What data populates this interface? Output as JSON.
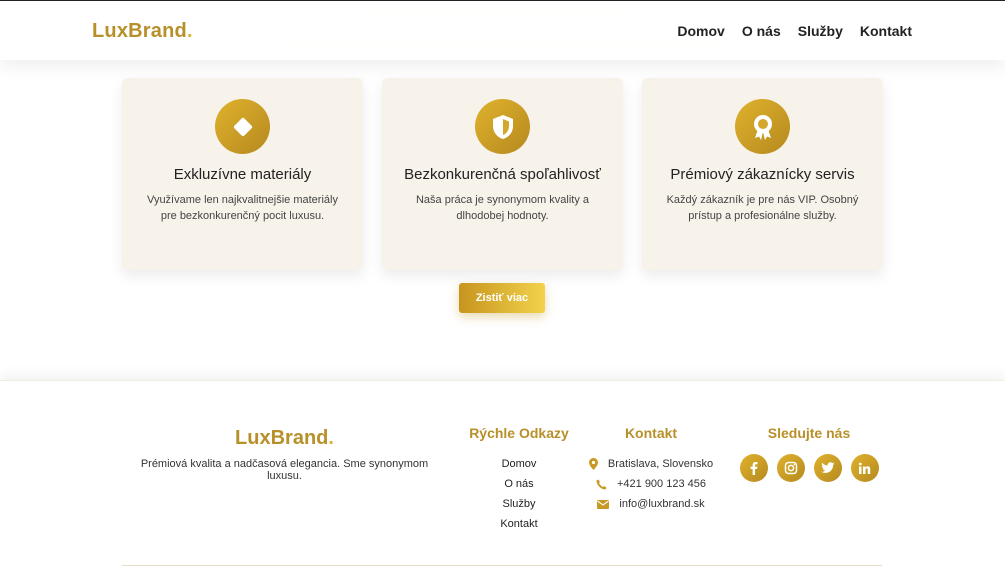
{
  "brand": {
    "name": "LuxBrand",
    "dot": "."
  },
  "nav": [
    "Domov",
    "O nás",
    "Služby",
    "Kontakt"
  ],
  "features": [
    {
      "icon": "diamond-icon",
      "title": "Exkluzívne materiály",
      "text": "Využívame len najkvalitnejšie materiály pre bezkonkurenčný pocit luxusu."
    },
    {
      "icon": "shield-icon",
      "title": "Bezkonkurenčná spoľahlivosť",
      "text": "Naša práca je synonymom kvality a dlhodobej hodnoty."
    },
    {
      "icon": "award-icon",
      "title": "Prémiový zákaznícky servis",
      "text": "Každý zákazník je pre nás VIP. Osobný prístup a profesionálne služby."
    }
  ],
  "cta": {
    "label": "Zistiť viac"
  },
  "footer": {
    "tagline": "Prémiová kvalita a nadčasová elegancia. Sme synonymom luxusu.",
    "quick_links": {
      "heading": "Rýchle Odkazy",
      "items": [
        "Domov",
        "O nás",
        "Služby",
        "Kontakt"
      ]
    },
    "contact": {
      "heading": "Kontakt",
      "address": "Bratislava, Slovensko",
      "phone": "+421 900 123 456",
      "email": "info@luxbrand.sk"
    },
    "social": {
      "heading": "Sledujte nás",
      "icons": [
        "facebook-icon",
        "instagram-icon",
        "twitter-icon",
        "linkedin-icon"
      ]
    }
  },
  "colors": {
    "gold": "#b8902a",
    "gold_light": "#e0b22d",
    "card_bg": "#f7f2ea"
  }
}
